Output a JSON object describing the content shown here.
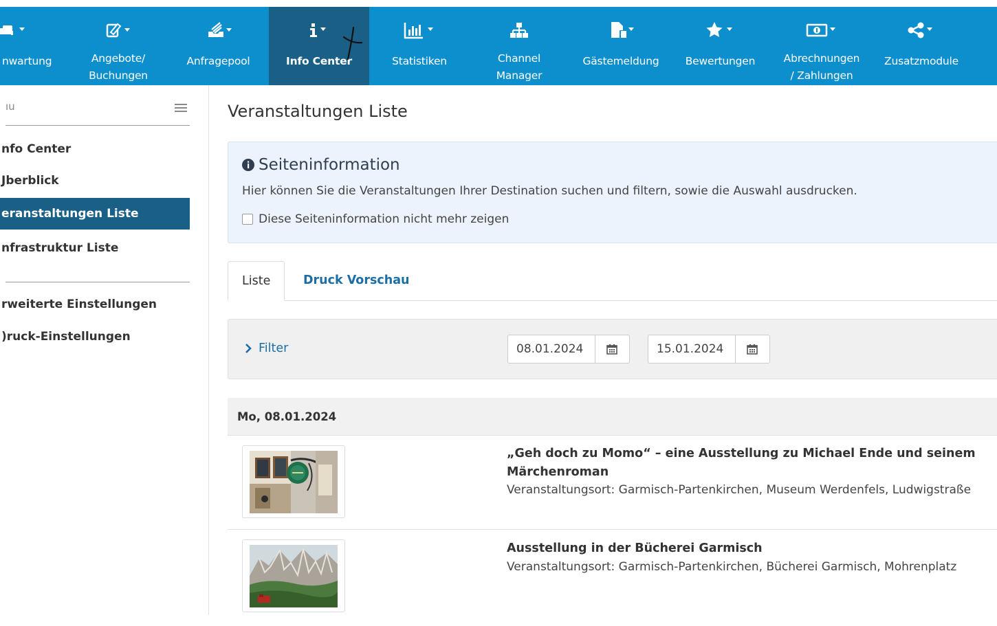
{
  "nav": {
    "items": [
      {
        "key": "wartung",
        "label": "nwartung",
        "icon": "bed-icon"
      },
      {
        "key": "angebote",
        "label_line1": "Angebote/",
        "label_line2": "Buchungen",
        "icon": "edit-icon"
      },
      {
        "key": "anfragepool",
        "label": "Anfragepool",
        "icon": "inbox-icon"
      },
      {
        "key": "infocenter",
        "label": "Info Center",
        "icon": "info-icon",
        "active": true
      },
      {
        "key": "statistiken",
        "label": "Statistiken",
        "icon": "bar-chart-icon"
      },
      {
        "key": "channel",
        "label_line1": "Channel",
        "label_line2": "Manager",
        "icon": "sitemap-icon"
      },
      {
        "key": "gaestemeldung",
        "label": "Gästemeldung",
        "icon": "document-icon"
      },
      {
        "key": "bewertungen",
        "label": "Bewertungen",
        "icon": "star-icon"
      },
      {
        "key": "abrechnungen",
        "label_line1": "Abrechnungen",
        "label_line2": "/ Zahlungen",
        "icon": "money-icon"
      },
      {
        "key": "zusatzmodule",
        "label": "Zusatzmodule",
        "icon": "share-icon"
      }
    ],
    "colors": {
      "bar": "#0d8fce",
      "active": "#1a5f86"
    }
  },
  "sidebar": {
    "search_text": "ıu",
    "items": [
      {
        "label": "nfo Center"
      },
      {
        "label": "Jberblick"
      },
      {
        "label": "eranstaltungen Liste",
        "active": true
      },
      {
        "label": "nfrastruktur Liste"
      },
      {
        "label": "rweiterte Einstellungen"
      },
      {
        "label": ")ruck-Einstellungen"
      }
    ]
  },
  "main": {
    "title": "Veranstaltungen Liste",
    "info": {
      "title": "Seiteninformation",
      "text": "Hier können Sie die Veranstaltungen Ihrer Destination suchen und filtern, sowie die Auswahl ausdrucken.",
      "checkbox_label": "Diese Seiteninformation nicht mehr zeigen"
    },
    "tabs": [
      {
        "label": "Liste",
        "active": true
      },
      {
        "label": "Druck Vorschau"
      }
    ],
    "filter": {
      "label": "Filter",
      "date_from": "08.01.2024",
      "date_to": "15.01.2024"
    },
    "day_header": "Mo, 08.01.2024",
    "events": [
      {
        "title": "„Geh doch zu Momo“ – eine Ausstellung zu Michael Ende und seinem Märchenroman",
        "place": "Veranstaltungsort: Garmisch-Partenkirchen, Museum Werdenfels, Ludwigstraße"
      },
      {
        "title": "Ausstellung in der Bücherei Garmisch",
        "place": "Veranstaltungsort: Garmisch-Partenkirchen, Bücherei Garmisch, Mohrenplatz"
      }
    ]
  }
}
